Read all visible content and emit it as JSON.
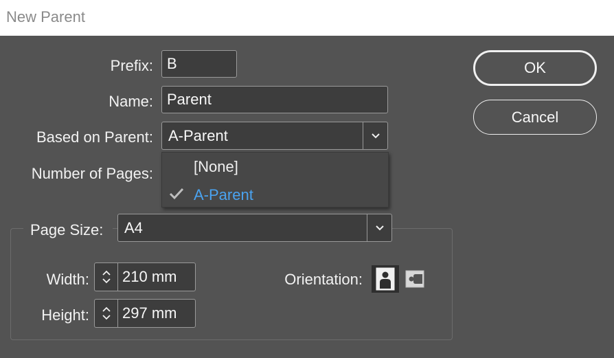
{
  "window": {
    "title": "New Parent"
  },
  "form": {
    "prefix_label": "Prefix:",
    "prefix_value": "B",
    "name_label": "Name:",
    "name_value": "Parent",
    "based_on_label": "Based on Parent:",
    "based_on_value": "A-Parent",
    "pages_label": "Number of Pages:"
  },
  "dropdown": {
    "options": [
      {
        "label": "[None]",
        "selected": false
      },
      {
        "label": "A-Parent",
        "selected": true
      }
    ],
    "selected_color": "#4aa3f0"
  },
  "page_size": {
    "label": "Page Size:",
    "value": "A4",
    "width_label": "Width:",
    "width_value": "210 mm",
    "height_label": "Height:",
    "height_value": "297 mm",
    "orientation_label": "Orientation:",
    "orientation_options": [
      "portrait-icon",
      "landscape-icon"
    ],
    "orientation_selected": "portrait"
  },
  "buttons": {
    "ok_label": "OK",
    "cancel_label": "Cancel"
  }
}
